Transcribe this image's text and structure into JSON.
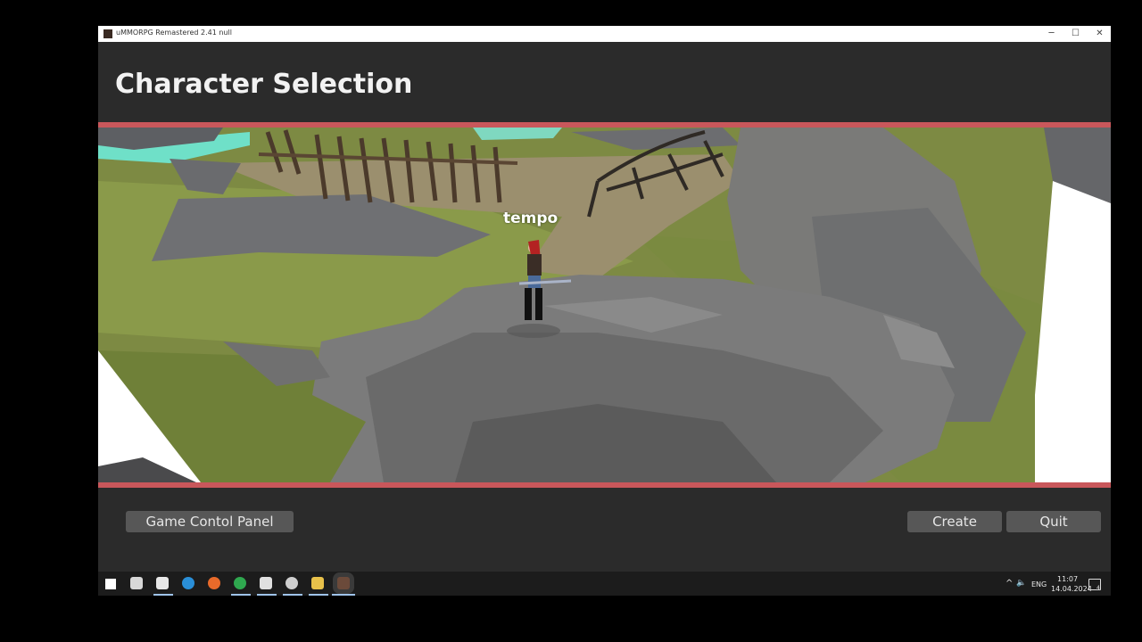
{
  "window": {
    "title": "uMMORPG Remastered 2.41 null",
    "minimize_glyph": "─",
    "maximize_glyph": "☐",
    "close_glyph": "✕"
  },
  "header": {
    "title": "Character Selection"
  },
  "scene": {
    "character_name": "tempo"
  },
  "buttons": {
    "control_panel": "Game Contol Panel",
    "create": "Create",
    "quit": "Quit"
  },
  "taskbar": {
    "apps": [
      "start-icon",
      "task-view-icon",
      "unity-hub-icon",
      "edge-icon",
      "firefox-icon",
      "chrome-icon",
      "unity-icon",
      "obs-icon",
      "file-explorer-icon",
      "game-icon"
    ],
    "tray": {
      "chevron": "^",
      "speaker": "🔈",
      "language": "ENG",
      "time": "11:07",
      "date": "14.04.2024",
      "notifications": "4"
    }
  },
  "colors": {
    "accent_bar": "#c9575b",
    "background": "#2b2b2b",
    "button": "#575757"
  }
}
